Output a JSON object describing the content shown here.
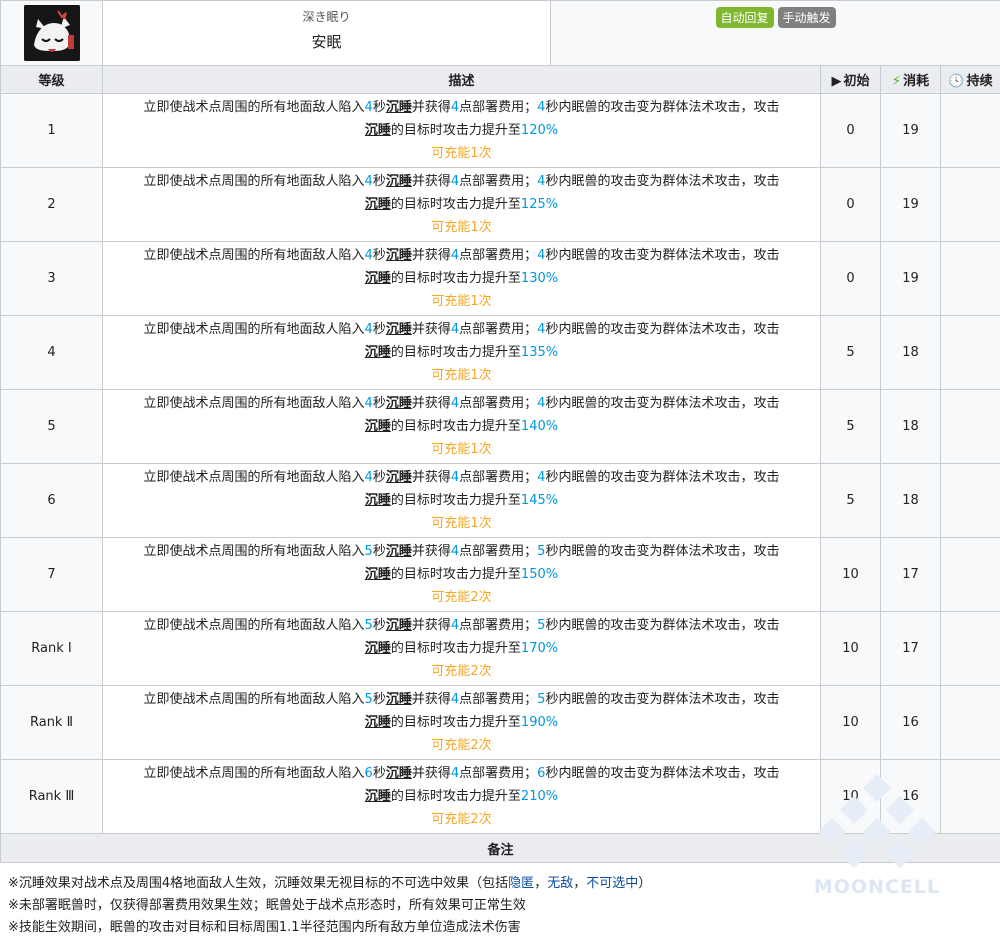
{
  "skill": {
    "name_sub": "深き眠り",
    "name": "安眠",
    "tags": [
      {
        "label": "自动回复",
        "color": "#7fb82f"
      },
      {
        "label": "手动触发",
        "color": "#808080"
      }
    ],
    "icon": "sleeping-beast-skill-icon"
  },
  "columns": {
    "level": "等级",
    "desc": "描述",
    "initial": "初始",
    "initial_icon": "play-icon",
    "cost": "消耗",
    "cost_icon": "lightning-icon",
    "duration": "持续",
    "duration_icon": "clock-icon"
  },
  "desc_template": {
    "part1": "立即使战术点周围的所有地面敌人陷入",
    "unit_sec": "秒",
    "keyword": "沉睡",
    "part2": "并获得",
    "dp": "4",
    "part3": "点部署费用；",
    "part4": "秒内眠兽的攻击变为群体法术攻击，攻击",
    "part5": "的目标时攻击力提升至"
  },
  "levels": [
    {
      "level": "1",
      "sec": "4",
      "pct": "120%",
      "charge": "可充能1次",
      "initial": "0",
      "cost": "19",
      "duration": ""
    },
    {
      "level": "2",
      "sec": "4",
      "pct": "125%",
      "charge": "可充能1次",
      "initial": "0",
      "cost": "19",
      "duration": ""
    },
    {
      "level": "3",
      "sec": "4",
      "pct": "130%",
      "charge": "可充能1次",
      "initial": "0",
      "cost": "19",
      "duration": ""
    },
    {
      "level": "4",
      "sec": "4",
      "pct": "135%",
      "charge": "可充能1次",
      "initial": "5",
      "cost": "18",
      "duration": ""
    },
    {
      "level": "5",
      "sec": "4",
      "pct": "140%",
      "charge": "可充能1次",
      "initial": "5",
      "cost": "18",
      "duration": ""
    },
    {
      "level": "6",
      "sec": "4",
      "pct": "145%",
      "charge": "可充能1次",
      "initial": "5",
      "cost": "18",
      "duration": ""
    },
    {
      "level": "7",
      "sec": "5",
      "pct": "150%",
      "charge": "可充能2次",
      "initial": "10",
      "cost": "17",
      "duration": ""
    },
    {
      "level": "Rank Ⅰ",
      "sec": "5",
      "pct": "170%",
      "charge": "可充能2次",
      "initial": "10",
      "cost": "17",
      "duration": ""
    },
    {
      "level": "Rank Ⅱ",
      "sec": "5",
      "pct": "190%",
      "charge": "可充能2次",
      "initial": "10",
      "cost": "16",
      "duration": ""
    },
    {
      "level": "Rank Ⅲ",
      "sec": "6",
      "pct": "210%",
      "charge": "可充能2次",
      "initial": "10",
      "cost": "16",
      "duration": ""
    }
  ],
  "notes": {
    "title": "备注",
    "line1_a": "※沉睡效果对战术点及周围4格地面敌人生效，沉睡效果无视目标的不可选中效果（包括",
    "line1_link1": "隐匿",
    "line1_sep1": "，",
    "line1_link2": "无敌",
    "line1_sep2": "，",
    "line1_link3": "不可选中",
    "line1_b": "）",
    "line2": "※未部署眠兽时，仅获得部署费用效果生效；眠兽处于战术点形态时，所有效果可正常生效",
    "line3": "※技能生效期间，眠兽的攻击对目标和目标周围1.1半径范围内所有敌方单位造成法术伤害"
  },
  "watermark": {
    "text": "MOONCELL"
  }
}
